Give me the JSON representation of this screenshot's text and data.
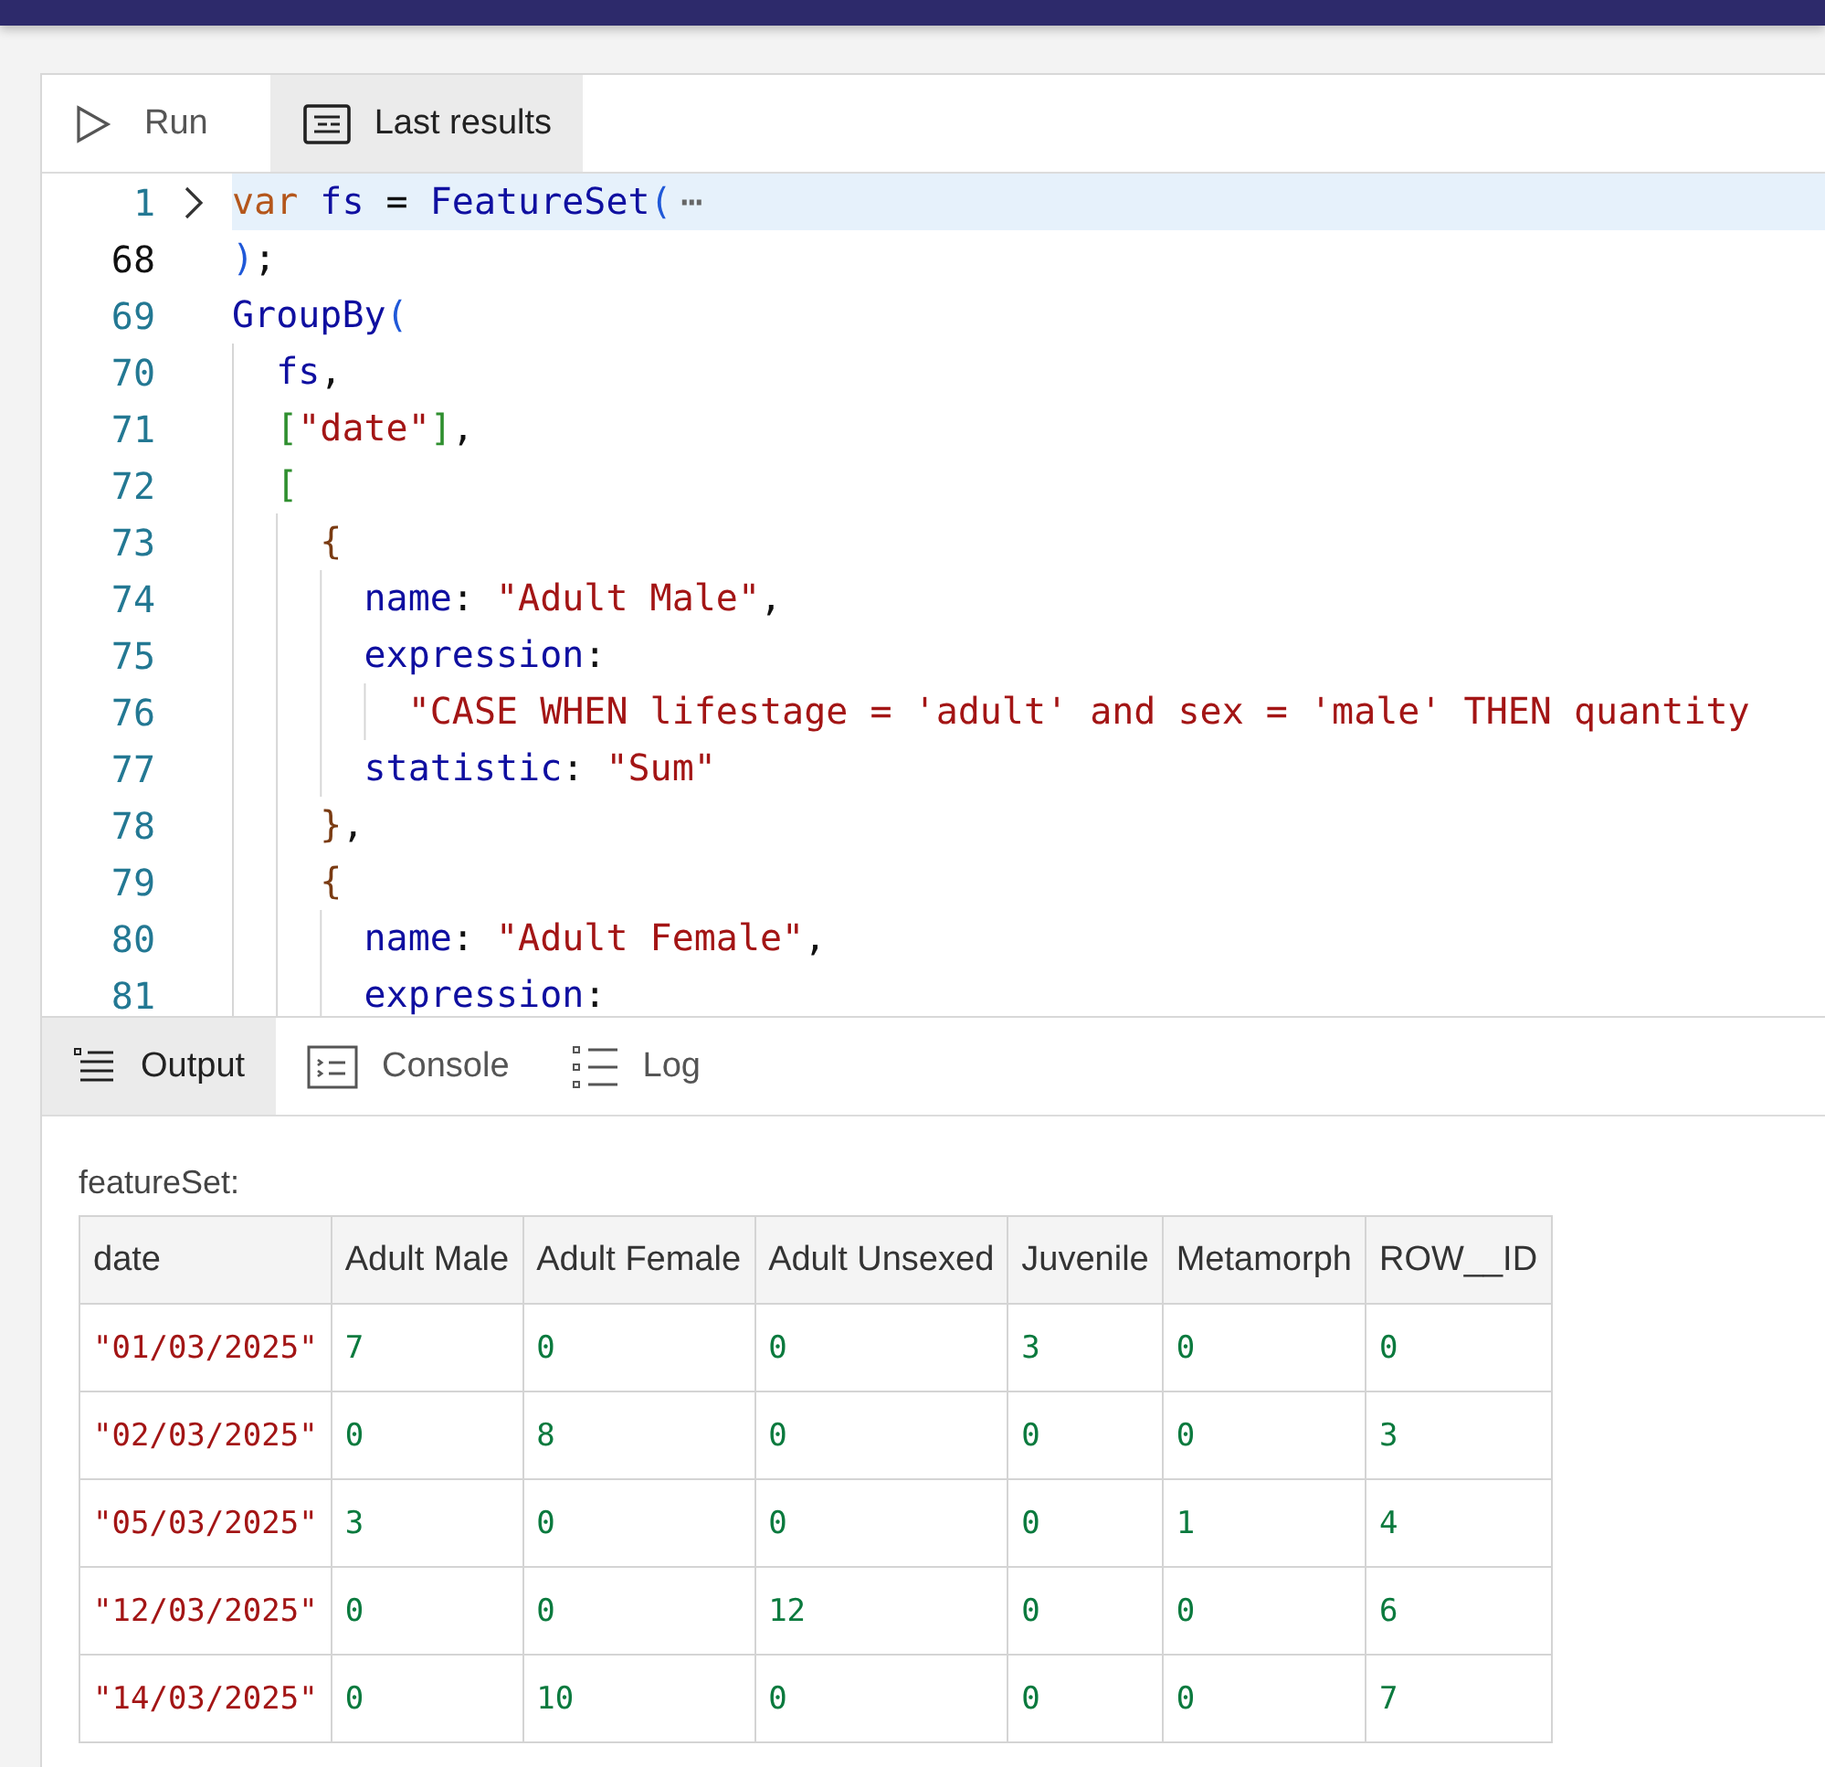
{
  "toolbar": {
    "tabs": [
      {
        "label": "Run",
        "selected": false
      },
      {
        "label": "Last results",
        "selected": true
      }
    ]
  },
  "editor": {
    "lines": [
      {
        "number": "1",
        "folded": true,
        "highlighted": true,
        "current": false,
        "tokens": [
          {
            "kind": "keyword",
            "text": "var"
          },
          {
            "kind": "ident",
            "text": " fs"
          },
          {
            "kind": "punct",
            "text": " = "
          },
          {
            "kind": "ident",
            "text": "FeatureSet"
          },
          {
            "kind": "paren",
            "text": "("
          },
          {
            "kind": "ellipsis",
            "text": "⋯"
          }
        ]
      },
      {
        "number": "68",
        "folded": false,
        "highlighted": false,
        "current": true,
        "tokens": [
          {
            "kind": "paren",
            "text": ")"
          },
          {
            "kind": "punct",
            "text": ";"
          }
        ]
      },
      {
        "number": "69",
        "folded": false,
        "highlighted": false,
        "current": false,
        "tokens": [
          {
            "kind": "ident",
            "text": "GroupBy"
          },
          {
            "kind": "paren",
            "text": "("
          }
        ]
      },
      {
        "number": "70",
        "folded": false,
        "highlighted": false,
        "current": false,
        "tokens": [
          {
            "kind": "ident",
            "text": "  fs"
          },
          {
            "kind": "punct",
            "text": ","
          }
        ]
      },
      {
        "number": "71",
        "folded": false,
        "highlighted": false,
        "current": false,
        "tokens": [
          {
            "kind": "bracket",
            "text": "  ["
          },
          {
            "kind": "string",
            "text": "\"date\""
          },
          {
            "kind": "bracket",
            "text": "]"
          },
          {
            "kind": "punct",
            "text": ","
          }
        ]
      },
      {
        "number": "72",
        "folded": false,
        "highlighted": false,
        "current": false,
        "tokens": [
          {
            "kind": "bracket",
            "text": "  ["
          }
        ]
      },
      {
        "number": "73",
        "folded": false,
        "highlighted": false,
        "current": false,
        "tokens": [
          {
            "kind": "brace",
            "text": "    {"
          }
        ]
      },
      {
        "number": "74",
        "folded": false,
        "highlighted": false,
        "current": false,
        "tokens": [
          {
            "kind": "ident",
            "text": "      name"
          },
          {
            "kind": "punct",
            "text": ": "
          },
          {
            "kind": "string",
            "text": "\"Adult Male\""
          },
          {
            "kind": "punct",
            "text": ","
          }
        ]
      },
      {
        "number": "75",
        "folded": false,
        "highlighted": false,
        "current": false,
        "tokens": [
          {
            "kind": "ident",
            "text": "      expression"
          },
          {
            "kind": "punct",
            "text": ":"
          }
        ]
      },
      {
        "number": "76",
        "folded": false,
        "highlighted": false,
        "current": false,
        "tokens": [
          {
            "kind": "string",
            "text": "        \"CASE WHEN lifestage = 'adult' and sex = 'male' THEN quantity"
          }
        ]
      },
      {
        "number": "77",
        "folded": false,
        "highlighted": false,
        "current": false,
        "tokens": [
          {
            "kind": "ident",
            "text": "      statistic"
          },
          {
            "kind": "punct",
            "text": ": "
          },
          {
            "kind": "string",
            "text": "\"Sum\""
          }
        ]
      },
      {
        "number": "78",
        "folded": false,
        "highlighted": false,
        "current": false,
        "tokens": [
          {
            "kind": "brace",
            "text": "    }"
          },
          {
            "kind": "punct",
            "text": ","
          }
        ]
      },
      {
        "number": "79",
        "folded": false,
        "highlighted": false,
        "current": false,
        "tokens": [
          {
            "kind": "brace",
            "text": "    {"
          }
        ]
      },
      {
        "number": "80",
        "folded": false,
        "highlighted": false,
        "current": false,
        "tokens": [
          {
            "kind": "ident",
            "text": "      name"
          },
          {
            "kind": "punct",
            "text": ": "
          },
          {
            "kind": "string",
            "text": "\"Adult Female\""
          },
          {
            "kind": "punct",
            "text": ","
          }
        ]
      },
      {
        "number": "81",
        "folded": false,
        "highlighted": false,
        "current": false,
        "tokens": [
          {
            "kind": "ident",
            "text": "      expression"
          },
          {
            "kind": "punct",
            "text": ":"
          }
        ]
      }
    ]
  },
  "output_tabs": [
    {
      "label": "Output",
      "selected": true
    },
    {
      "label": "Console",
      "selected": false
    },
    {
      "label": "Log",
      "selected": false
    }
  ],
  "output": {
    "title": "featureSet:",
    "table": {
      "columns": [
        {
          "label": "date",
          "kind": "string"
        },
        {
          "label": "Adult Male",
          "kind": "number"
        },
        {
          "label": "Adult Female",
          "kind": "number"
        },
        {
          "label": "Adult Unsexed",
          "kind": "number"
        },
        {
          "label": "Juvenile",
          "kind": "number"
        },
        {
          "label": "Metamorph",
          "kind": "number"
        },
        {
          "label": "ROW__ID",
          "kind": "number"
        }
      ],
      "rows": [
        [
          "\"01/03/2025\"",
          "7",
          "0",
          "0",
          "3",
          "0",
          "0"
        ],
        [
          "\"02/03/2025\"",
          "0",
          "8",
          "0",
          "0",
          "0",
          "3"
        ],
        [
          "\"05/03/2025\"",
          "3",
          "0",
          "0",
          "0",
          "1",
          "4"
        ],
        [
          "\"12/03/2025\"",
          "0",
          "0",
          "12",
          "0",
          "0",
          "6"
        ],
        [
          "\"14/03/2025\"",
          "0",
          "10",
          "0",
          "0",
          "0",
          "7"
        ]
      ]
    }
  }
}
